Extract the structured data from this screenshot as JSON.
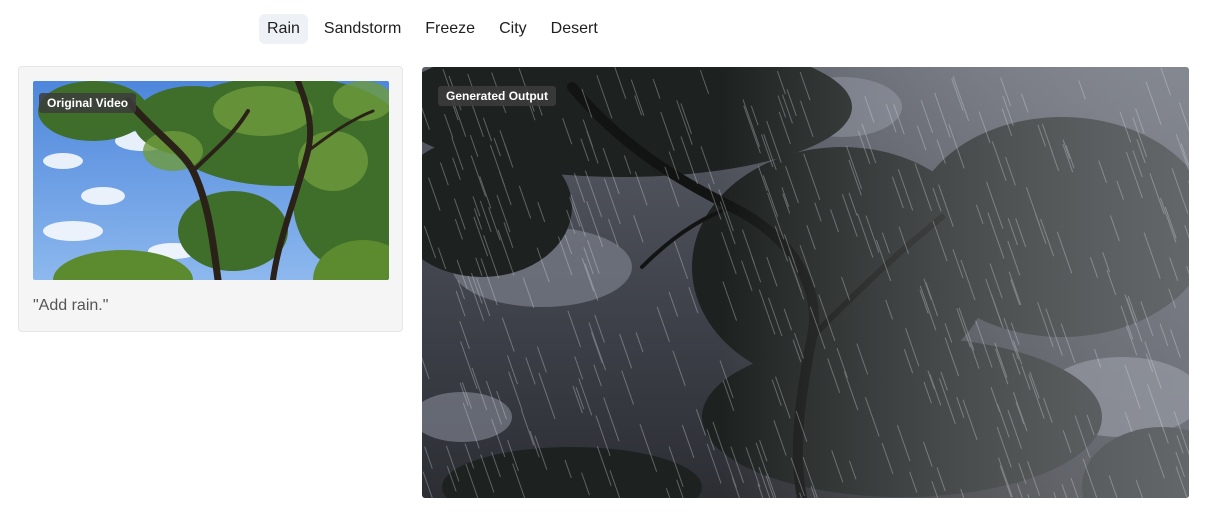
{
  "tabs": [
    {
      "label": "Rain",
      "active": true
    },
    {
      "label": "Sandstorm",
      "active": false
    },
    {
      "label": "Freeze",
      "active": false
    },
    {
      "label": "City",
      "active": false
    },
    {
      "label": "Desert",
      "active": false
    }
  ],
  "input": {
    "label": "Original Video",
    "prompt": "\"Add rain.\""
  },
  "output": {
    "label": "Generated Output"
  },
  "colors": {
    "active_tab_bg": "#eef2f6",
    "card_bg": "#f5f5f5",
    "label_bg": "#3c3c3c",
    "sky_blue": "#5a8fe0",
    "storm_gray": "#4a4d55"
  }
}
